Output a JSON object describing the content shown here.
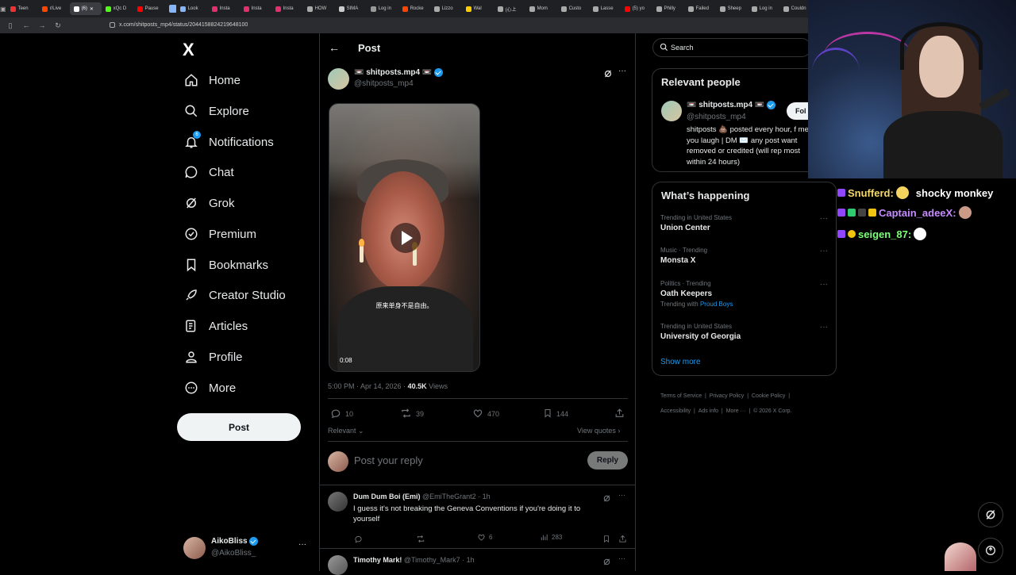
{
  "browser": {
    "tabs": [
      "Teen",
      "r/Live",
      "(6)",
      "xQc D",
      "Pause",
      "",
      "Look",
      "Insta",
      "Insta",
      "Insta",
      "HOW",
      "SIMA",
      "Log in",
      "Rocke",
      "Lizzo",
      "Wal",
      "(心上",
      "Mom",
      "Custo",
      "Lasse",
      "(5) yo",
      "Philly",
      "Failed",
      "Sheep",
      "Log in",
      "Couldn"
    ],
    "url": "x.com/shitposts_mp4/status/2044158824219648100"
  },
  "nav": {
    "logo": "X",
    "items": [
      {
        "label": "Home"
      },
      {
        "label": "Explore"
      },
      {
        "label": "Notifications",
        "badge": "6"
      },
      {
        "label": "Chat"
      },
      {
        "label": "Grok"
      },
      {
        "label": "Premium"
      },
      {
        "label": "Bookmarks"
      },
      {
        "label": "Creator Studio"
      },
      {
        "label": "Articles"
      },
      {
        "label": "Profile"
      },
      {
        "label": "More"
      }
    ],
    "post_button": "Post",
    "account": {
      "name": "AikoBliss",
      "handle": "@AikoBliss_",
      "more": "···"
    }
  },
  "post": {
    "header_title": "Post",
    "author_name": "📼 shitposts.mp4 📼",
    "author_handle": "@shitposts_mp4",
    "video_subtitle": "原来单身不是自由。",
    "video_duration": "0:08",
    "timestamp": "5:00 PM · Apr 14, 2026 ·",
    "views_count": "40.5K",
    "views_label": "Views",
    "replies": "10",
    "reposts": "39",
    "likes": "470",
    "bookmarks": "144",
    "sort_label": "Relevant",
    "view_quotes": "View quotes",
    "reply_placeholder": "Post your reply",
    "reply_button": "Reply"
  },
  "replies": [
    {
      "name": "Dum Dum Boi (Emi)",
      "handle": "@EmiTheGrant2 · 1h",
      "text": "I guess it's not breaking the Geneva Conventions if you're doing it to yourself",
      "likes": "6",
      "views": "283"
    },
    {
      "name": "Timothy Mark!",
      "handle": "@Timothy_Mark7 · 1h",
      "text": ""
    }
  ],
  "right": {
    "search_placeholder": "Search",
    "relevant_title": "Relevant people",
    "person_name": "📼 shitposts.mp4 📼",
    "person_handle": "@shitposts_mp4",
    "person_follow": "Fol",
    "person_bio": "shitposts 💩 posted every hour, f me if you laugh | DM ✉️ any post want removed or credited (will rep most within 24 hours)",
    "happening_title": "What’s happening",
    "trends": [
      {
        "context": "Trending in United States",
        "name": "Union Center"
      },
      {
        "context": "Music · Trending",
        "name": "Monsta X"
      },
      {
        "context": "Politics · Trending",
        "name": "Oath Keepers",
        "with_label": "Trending with",
        "with_link": "Proud Boys"
      },
      {
        "context": "Trending in United States",
        "name": "University of Georgia"
      }
    ],
    "show_more": "Show more",
    "footer": [
      "Terms of Service",
      "Privacy Policy",
      "Cookie Policy",
      "Accessibility",
      "Ads info",
      "More ···",
      "© 2026 X Corp."
    ]
  },
  "stream_chat": [
    {
      "user": "Snufferd:",
      "color": "#f5d76e",
      "message": "shocky monkey"
    },
    {
      "user": "Captain_adeeX:",
      "color": "#c58cff",
      "message": ""
    },
    {
      "user": "seigen_87:",
      "color": "#7dff7a",
      "message": ""
    }
  ],
  "colors": {
    "accent": "#1d9bf0",
    "background": "#000000",
    "border": "#2f3336",
    "muted": "#71767b"
  }
}
